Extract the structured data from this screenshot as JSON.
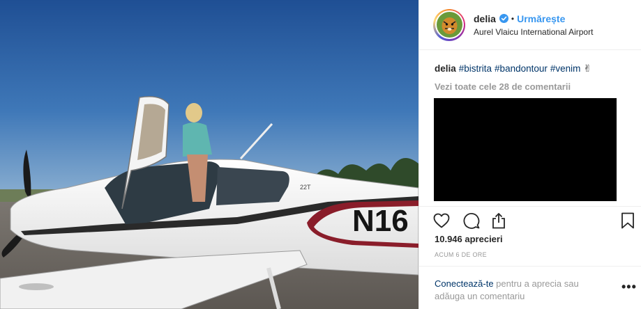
{
  "photo": {
    "alt_icon": "airplane-photo",
    "tail_number": "N16",
    "model_badge": "22T"
  },
  "header": {
    "username": "delia",
    "separator": "•",
    "follow_label": "Urmărește",
    "location": "Aurel Vlaicu International Airport",
    "verified_icon": "verified-badge-icon"
  },
  "caption": {
    "username": "delia",
    "hashtags": [
      "#bistrita",
      "#bandontour",
      "#venim"
    ],
    "emoji": "✌"
  },
  "comments": {
    "view_all_label": "Vezi toate cele 28 de comentarii"
  },
  "actions": {
    "like_icon": "heart-icon",
    "comment_icon": "comment-icon",
    "share_icon": "share-icon",
    "save_icon": "bookmark-icon"
  },
  "stats": {
    "likes_text": "10.946 aprecieri",
    "time_text": "ACUM 6 DE ORE"
  },
  "login_prompt": {
    "link_text": "Conectează-te",
    "rest_text": " pentru a aprecia sau adăuga un comentariu",
    "more_label": "•••"
  },
  "colors": {
    "accent": "#3897f0",
    "link": "#003569",
    "muted": "#999999",
    "text": "#262626",
    "border": "#efefef"
  }
}
